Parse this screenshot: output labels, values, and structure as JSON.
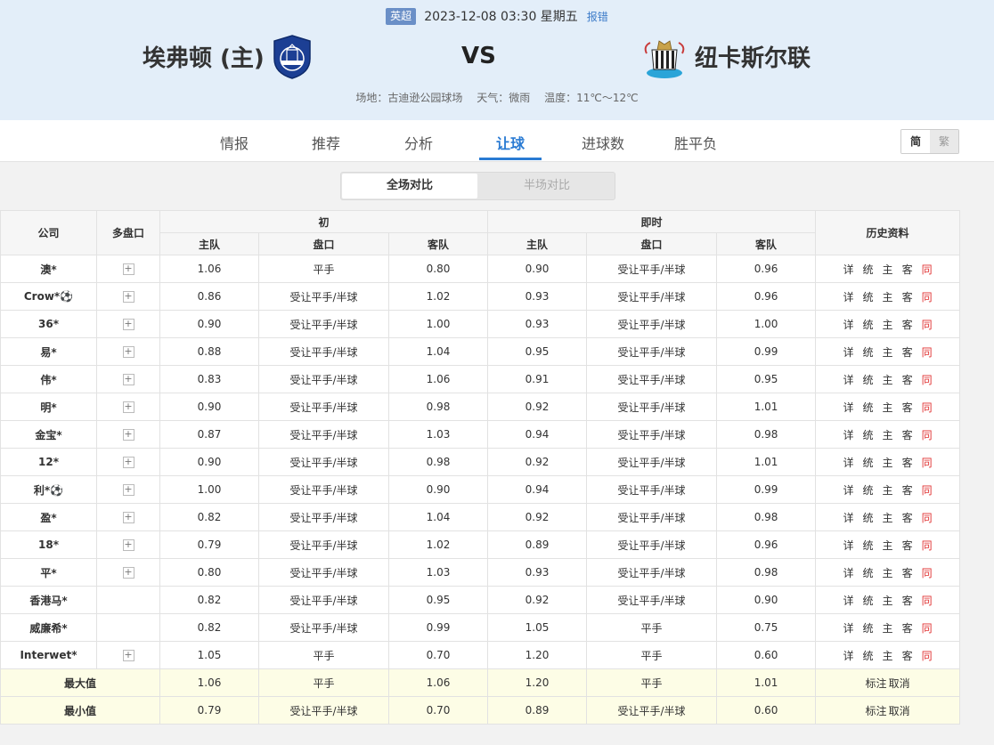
{
  "match": {
    "league": "英超",
    "datetime": "2023-12-08 03:30 星期五",
    "report": "报错",
    "home": "埃弗顿 (主)",
    "vs": "VS",
    "away": "纽卡斯尔联",
    "venue": "场地：古迪逊公园球场",
    "weather": "天气：微雨",
    "temperature": "温度：11℃～12℃"
  },
  "tabs": [
    "情报",
    "推荐",
    "分析",
    "让球",
    "进球数",
    "胜平负"
  ],
  "active_tab": "让球",
  "lang": {
    "simplified": "简",
    "traditional": "繁"
  },
  "compare": {
    "full": "全场对比",
    "half": "半场对比"
  },
  "table": {
    "headers": {
      "company": "公司",
      "multi": "多盘口",
      "initial": "初",
      "live": "即时",
      "history": "历史资料",
      "home": "主队",
      "handicap": "盘口",
      "away": "客队"
    },
    "history_links": [
      "详",
      "统",
      "主",
      "客",
      "同"
    ],
    "rows": [
      {
        "company": "澳*",
        "plus": true,
        "i_home": "1.06",
        "i_line": "平手",
        "i_away": "0.80",
        "l_home": "0.90",
        "l_line": "受让平手/半球",
        "l_away": "0.96"
      },
      {
        "company": "Crow*⚽",
        "plus": true,
        "i_home": "0.86",
        "i_line": "受让平手/半球",
        "i_away": "1.02",
        "l_home": "0.93",
        "l_line": "受让平手/半球",
        "l_away": "0.96"
      },
      {
        "company": "36*",
        "plus": true,
        "i_home": "0.90",
        "i_line": "受让平手/半球",
        "i_away": "1.00",
        "l_home": "0.93",
        "l_line": "受让平手/半球",
        "l_away": "1.00"
      },
      {
        "company": "易*",
        "plus": true,
        "i_home": "0.88",
        "i_line": "受让平手/半球",
        "i_away": "1.04",
        "l_home": "0.95",
        "l_line": "受让平手/半球",
        "l_away": "0.99"
      },
      {
        "company": "伟*",
        "plus": true,
        "i_home": "0.83",
        "i_line": "受让平手/半球",
        "i_away": "1.06",
        "l_home": "0.91",
        "l_line": "受让平手/半球",
        "l_away": "0.95"
      },
      {
        "company": "明*",
        "plus": true,
        "i_home": "0.90",
        "i_line": "受让平手/半球",
        "i_away": "0.98",
        "l_home": "0.92",
        "l_line": "受让平手/半球",
        "l_away": "1.01"
      },
      {
        "company": "金宝*",
        "plus": true,
        "i_home": "0.87",
        "i_line": "受让平手/半球",
        "i_away": "1.03",
        "l_home": "0.94",
        "l_line": "受让平手/半球",
        "l_away": "0.98"
      },
      {
        "company": "12*",
        "plus": true,
        "i_home": "0.90",
        "i_line": "受让平手/半球",
        "i_away": "0.98",
        "l_home": "0.92",
        "l_line": "受让平手/半球",
        "l_away": "1.01"
      },
      {
        "company": "利*⚽",
        "plus": true,
        "i_home": "1.00",
        "i_line": "受让平手/半球",
        "i_away": "0.90",
        "l_home": "0.94",
        "l_line": "受让平手/半球",
        "l_away": "0.99"
      },
      {
        "company": "盈*",
        "plus": true,
        "i_home": "0.82",
        "i_line": "受让平手/半球",
        "i_away": "1.04",
        "l_home": "0.92",
        "l_line": "受让平手/半球",
        "l_away": "0.98"
      },
      {
        "company": "18*",
        "plus": true,
        "i_home": "0.79",
        "i_line": "受让平手/半球",
        "i_away": "1.02",
        "l_home": "0.89",
        "l_line": "受让平手/半球",
        "l_away": "0.96"
      },
      {
        "company": "平*",
        "plus": true,
        "i_home": "0.80",
        "i_line": "受让平手/半球",
        "i_away": "1.03",
        "l_home": "0.93",
        "l_line": "受让平手/半球",
        "l_away": "0.98"
      },
      {
        "company": "香港马*",
        "plus": false,
        "i_home": "0.82",
        "i_line": "受让平手/半球",
        "i_away": "0.95",
        "l_home": "0.92",
        "l_line": "受让平手/半球",
        "l_away": "0.90"
      },
      {
        "company": "威廉希*",
        "plus": false,
        "i_home": "0.82",
        "i_line": "受让平手/半球",
        "i_away": "0.99",
        "l_home": "1.05",
        "l_line": "平手",
        "l_away": "0.75"
      },
      {
        "company": "Interwet*",
        "plus": true,
        "i_home": "1.05",
        "i_line": "平手",
        "i_away": "0.70",
        "l_home": "1.20",
        "l_line": "平手",
        "l_away": "0.60"
      }
    ],
    "summary": [
      {
        "label": "最大值",
        "i_home": "1.06",
        "i_line": "平手",
        "i_away": "1.06",
        "l_home": "1.20",
        "l_line": "平手",
        "l_away": "1.01",
        "mark": "标注",
        "cancel": "取消"
      },
      {
        "label": "最小值",
        "i_home": "0.79",
        "i_line": "受让平手/半球",
        "i_away": "0.70",
        "l_home": "0.89",
        "l_line": "受让平手/半球",
        "l_away": "0.60",
        "mark": "标注",
        "cancel": "取消"
      }
    ]
  },
  "colors": {
    "accent": "#2a7bd3",
    "header_bg": "#e3eef9",
    "summary_bg": "#fdfde6",
    "history_red": "#e03030"
  },
  "icons": {
    "home_crest": "everton-crest-icon",
    "away_crest": "newcastle-crest-icon",
    "expand": "plus-icon"
  }
}
